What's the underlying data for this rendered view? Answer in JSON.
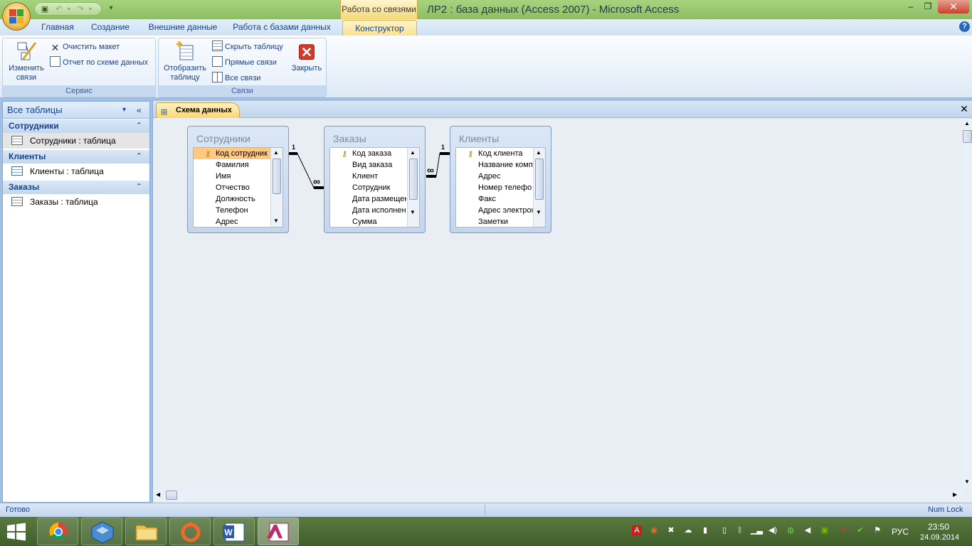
{
  "window": {
    "title": "ЛР2 : база данных (Access 2007)  -  Microsoft Access",
    "context_tab": "Работа со связями",
    "minimize": "–",
    "restore": "❐",
    "close": "✕"
  },
  "ribbon_tabs": [
    {
      "label": "Главная"
    },
    {
      "label": "Создание"
    },
    {
      "label": "Внешние данные"
    },
    {
      "label": "Работа с базами данных"
    },
    {
      "label": "Конструктор"
    }
  ],
  "ribbon": {
    "service": {
      "title": "Сервис",
      "edit_relations": {
        "line1": "Изменить",
        "line2": "связи"
      },
      "clear_layout": "Очистить макет",
      "relations_report": "Отчет по схеме данных"
    },
    "relations": {
      "title": "Связи",
      "show_table": {
        "line1": "Отобразить",
        "line2": "таблицу"
      },
      "hide_table": "Скрыть таблицу",
      "direct_relations": "Прямые связи",
      "all_relations": "Все связи",
      "close": "Закрыть"
    }
  },
  "nav": {
    "header": "Все таблицы",
    "groups": [
      {
        "name": "Сотрудники",
        "item": "Сотрудники : таблица"
      },
      {
        "name": "Клиенты",
        "item": "Клиенты : таблица"
      },
      {
        "name": "Заказы",
        "item": "Заказы : таблица"
      }
    ]
  },
  "document": {
    "tab": "Схема данных",
    "tables": [
      {
        "name": "Сотрудники",
        "fields": [
          "Код сотрудник",
          "Фамилия",
          "Имя",
          "Отчество",
          "Должность",
          "Телефон",
          "Адрес"
        ]
      },
      {
        "name": "Заказы",
        "fields": [
          "Код заказа",
          "Вид заказа",
          "Клиент",
          "Сотрудник",
          "Дата размещен",
          "Дата исполнен",
          "Сумма"
        ]
      },
      {
        "name": "Клиенты",
        "fields": [
          "Код клиента",
          "Название комп",
          "Адрес",
          "Номер телефо",
          "Факс",
          "Адрес электрон",
          "Заметки"
        ]
      }
    ],
    "relation_one": "1",
    "relation_many": "∞"
  },
  "status": {
    "left": "Готово",
    "right": "Num Lock"
  },
  "taskbar": {
    "apps": [
      "chrome",
      "virtualbox",
      "file-explorer",
      "origin",
      "word",
      "access"
    ],
    "lang": "РУС",
    "time": "23:50",
    "date": "24.09.2014"
  },
  "colors": {
    "title_bar": "#9ccb72",
    "ribbon_active_tab": "#fbe292",
    "key_field_highlight": "#ffc880",
    "close_red": "#c8402c"
  }
}
